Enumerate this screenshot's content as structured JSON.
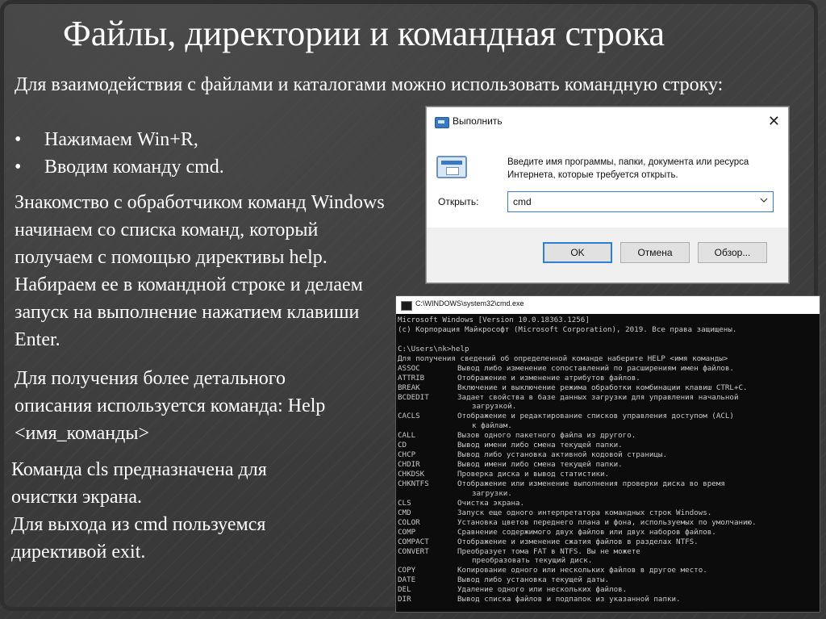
{
  "slide": {
    "title": "Файлы, директории и командная строка",
    "intro": "Для взаимодействия с файлами и каталогами можно использовать командную строку:",
    "bullet_char": "•",
    "bullets": [
      "Нажимаем Win+R,",
      "Вводим команду cmd."
    ],
    "paragraph2": "Знакомство с обработчиком команд Windows начинаем со списка команд, который получаем с помощью директивы help. Набираем ее в командной строке и делаем запуск на выполнение нажатием клавиши Enter.",
    "paragraph3": "Для получения более детального описания используется команда: Help <имя_команды>",
    "paragraph4_line1": "Команда cls предназначена для очистки экрана.",
    "paragraph4_line2": "Для выхода из cmd пользуемся директивой exit."
  },
  "run_dialog": {
    "title": "Выполнить",
    "close": "✕",
    "description": "Введите имя программы, папки, документа или ресурса Интернета, которые требуется открыть.",
    "label": "Открыть:",
    "input_value": "cmd",
    "dropdown_icon": "chevron-down-icon",
    "ok": "OK",
    "cancel": "Отмена",
    "browse": "Обзор..."
  },
  "cmd_window": {
    "title": "C:\\WINDOWS\\system32\\cmd.exe",
    "lines": [
      "Microsoft Windows [Version 10.0.18363.1256]",
      "(c) Корпорация Майкрософт (Microsoft Corporation), 2019. Все права защищены.",
      "",
      "C:\\Users\\nk>help",
      "Для получения сведений об определенной команде наберите HELP <имя команды>"
    ],
    "commands": [
      {
        "name": "ASSOC",
        "desc": "Вывод либо изменение сопоставлений по расширениям имен файлов."
      },
      {
        "name": "ATTRIB",
        "desc": "Отображение и изменение атрибутов файлов."
      },
      {
        "name": "BREAK",
        "desc": "Включение и выключение режима обработки комбинации клавиш CTRL+C."
      },
      {
        "name": "BCDEDIT",
        "desc": "Задает свойства в базе данных загрузки для управления начальной",
        "cont": "загрузкой."
      },
      {
        "name": "CACLS",
        "desc": "Отображение и редактирование списков управления доступом (ACL)",
        "cont": "к файлам."
      },
      {
        "name": "CALL",
        "desc": "Вызов одного пакетного файла из другого."
      },
      {
        "name": "CD",
        "desc": "Вывод имени либо смена текущей папки."
      },
      {
        "name": "CHCP",
        "desc": "Вывод либо установка активной кодовой страницы."
      },
      {
        "name": "CHDIR",
        "desc": "Вывод имени либо смена текущей папки."
      },
      {
        "name": "CHKDSK",
        "desc": "Проверка диска и вывод статистики."
      },
      {
        "name": "CHKNTFS",
        "desc": "Отображение или изменение выполнения проверки диска во время",
        "cont": "загрузки."
      },
      {
        "name": "CLS",
        "desc": "Очистка экрана."
      },
      {
        "name": "CMD",
        "desc": "Запуск еще одного интерпретатора командных строк Windows."
      },
      {
        "name": "COLOR",
        "desc": "Установка цветов переднего плана и фона, используемых по умолчанию."
      },
      {
        "name": "COMP",
        "desc": "Сравнение содержимого двух файлов или двух наборов файлов."
      },
      {
        "name": "COMPACT",
        "desc": "Отображение и изменение сжатия файлов в разделах NTFS."
      },
      {
        "name": "CONVERT",
        "desc": "Преобразует тома FAT в NTFS. Вы не можете",
        "cont": "преобразовать текущий диск."
      },
      {
        "name": "COPY",
        "desc": "Копирование одного или нескольких файлов в другое место."
      },
      {
        "name": "DATE",
        "desc": "Вывод либо установка текущей даты."
      },
      {
        "name": "DEL",
        "desc": "Удаление одного или нескольких файлов."
      },
      {
        "name": "DIR",
        "desc": "Вывод списка файлов и подпапок из указанной папки."
      }
    ]
  },
  "colors": {
    "background": "#3d3d3d",
    "text": "#ffffff",
    "cmd_background": "#0c0c0c",
    "cmd_text": "#c8c8c8",
    "accent_blue": "#2d7fd6"
  }
}
